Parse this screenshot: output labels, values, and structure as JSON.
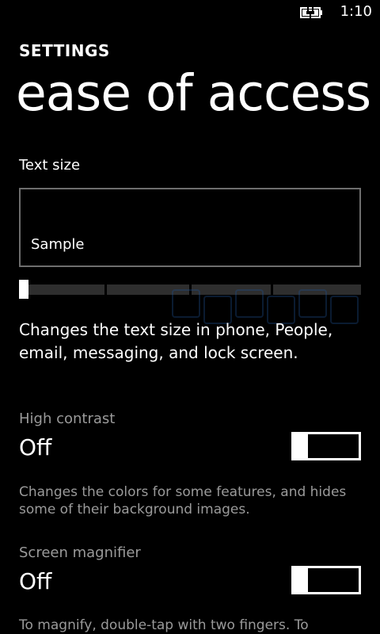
{
  "status_bar": {
    "time": "1:10",
    "battery_icon": "battery-charging-icon"
  },
  "header": {
    "section": "SETTINGS",
    "title": "ease of access"
  },
  "text_size": {
    "label": "Text size",
    "sample": "Sample",
    "slider_level": 0,
    "slider_steps": 4,
    "description": "Changes the text size in phone, People, email, messaging, and lock screen."
  },
  "high_contrast": {
    "label": "High contrast",
    "value": "Off",
    "description": "Changes the colors for some features, and hides some of their background images."
  },
  "screen_magnifier": {
    "label": "Screen magnifier",
    "value": "Off",
    "description": "To magnify, double-tap with two fingers. To"
  },
  "colors": {
    "background": "#000000",
    "text": "#ffffff",
    "secondary_text": "#9a9a9a",
    "slider_track": "#2e2e2e"
  }
}
